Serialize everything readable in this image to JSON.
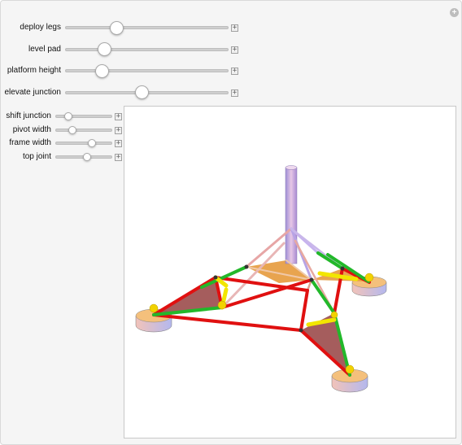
{
  "top_controls": [
    {
      "label": "deploy legs",
      "value": 0.3
    },
    {
      "label": "level pad",
      "value": 0.22
    },
    {
      "label": "platform height",
      "value": 0.2
    },
    {
      "label": "elevate junction",
      "value": 0.47
    }
  ],
  "side_controls": [
    {
      "label": "shift junction",
      "value": 0.18
    },
    {
      "label": "pivot width",
      "value": 0.27
    },
    {
      "label": "frame width",
      "value": 0.66
    },
    {
      "label": "top joint",
      "value": 0.57
    }
  ],
  "icons": {
    "add": "plus-circle-icon",
    "expand": "plus-square-icon"
  },
  "colors": {
    "background": "#f5f5f5",
    "strut_red": "#e01010",
    "strut_green": "#22b82a",
    "strut_yellow": "#f2e600",
    "pad_orange": "#f4c07c",
    "pad_blue": "#c4c4f0",
    "mast": "#c9aadb",
    "plate_brown": "#9b4b4b",
    "plate_orange": "#e69a3c"
  }
}
